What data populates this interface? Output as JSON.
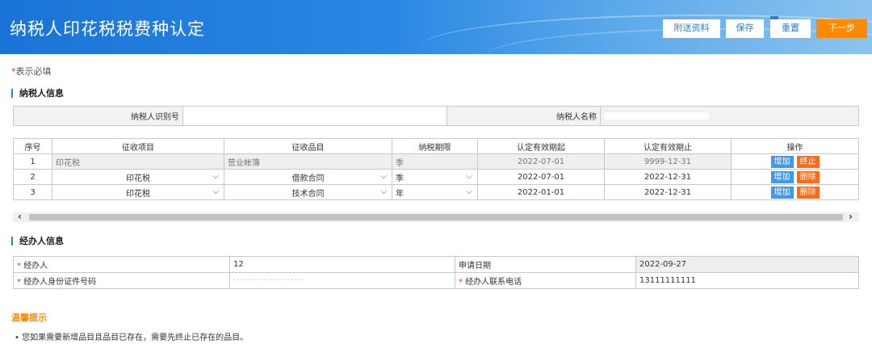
{
  "header": {
    "title": "纳税人印花税税费种认定",
    "buttons": {
      "attach": "附送资料",
      "save": "保存",
      "reset": "重置",
      "next": "下一步"
    }
  },
  "required_note": {
    "star": "*",
    "text": "表示必填"
  },
  "taxpayer_section": {
    "title": "纳税人信息",
    "id_label": "纳税人识别号",
    "id_value": "",
    "name_label": "纳税人名称",
    "name_value": ""
  },
  "tax_table": {
    "headers": [
      "序号",
      "征收项目",
      "征收品目",
      "纳税期限",
      "认定有效期起",
      "认定有效期止",
      "操作"
    ],
    "rows": [
      {
        "no": "1",
        "item": "印花税",
        "sub": "营业帐簿",
        "period": "季",
        "start": "2022-07-01",
        "end": "9999-12-31",
        "add": "增加",
        "action": "终止"
      },
      {
        "no": "2",
        "item": "印花税",
        "sub": "借款合同",
        "period": "季",
        "start": "2022-07-01",
        "end": "2022-12-31",
        "add": "增加",
        "action": "删除"
      },
      {
        "no": "3",
        "item": "印花税",
        "sub": "技术合同",
        "period": "年",
        "start": "2022-01-01",
        "end": "2022-12-31",
        "add": "增加",
        "action": "删除"
      }
    ]
  },
  "agent_section": {
    "title": "经办人信息",
    "agent_label": "经办人",
    "agent_value": "12",
    "apply_date_label": "申请日期",
    "apply_date_value": "2022-09-27",
    "id_no_label": "经办人身份证件号码",
    "id_no_value": "",
    "phone_label": "经办人联系电话",
    "phone_value": "13111111111",
    "required_star": "*"
  },
  "tips": {
    "title": "温馨提示",
    "items": [
      "• 您如果需要新增品目且品目已存在，需要先终止已存在的品目。"
    ]
  },
  "icons": {
    "chevron": "chevron-down-icon",
    "scroll_left": "chevron-left-icon",
    "scroll_right": "chevron-right-icon"
  },
  "colors": {
    "header_blue": "#1a74d6",
    "next_orange": "#ff8a00",
    "add_blue": "#3d9af0",
    "delete_orange": "#ff6a1a",
    "required_red": "#e03a3a"
  }
}
